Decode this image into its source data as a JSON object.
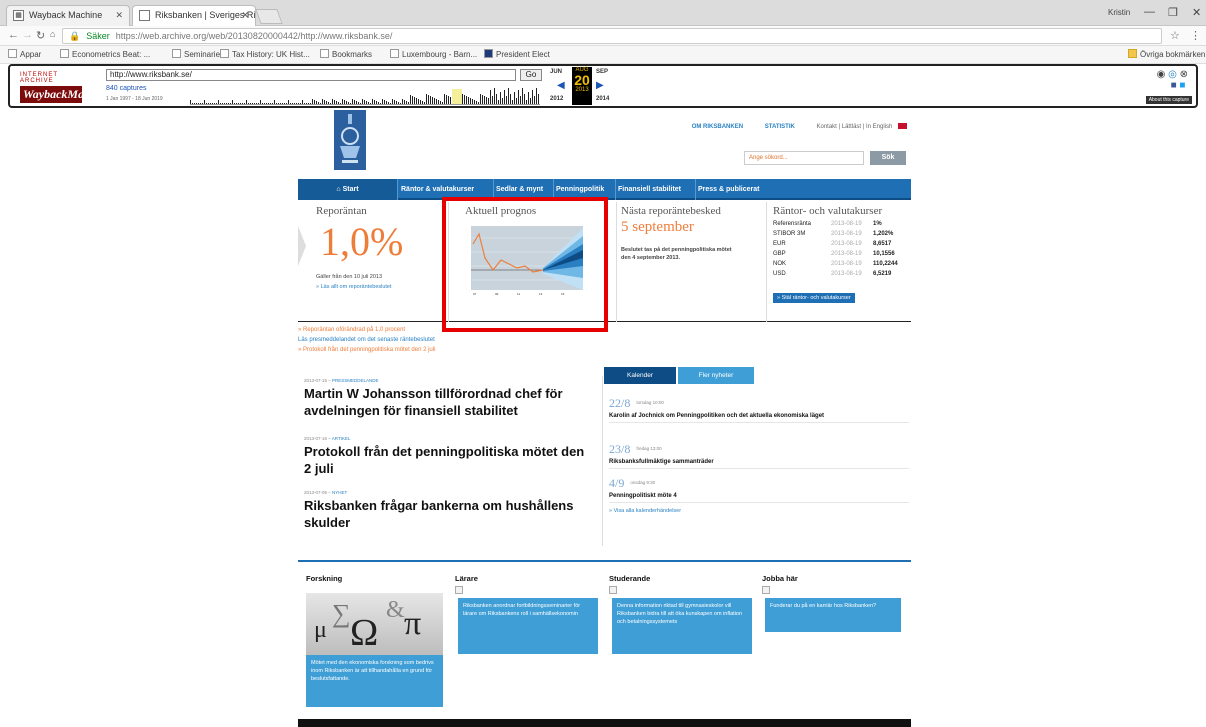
{
  "browser": {
    "tabs": [
      {
        "title": "Wayback Machine",
        "icon": "wayback-favicon"
      },
      {
        "title": "Riksbanken | Sveriges Ri...",
        "icon": "page-favicon"
      }
    ],
    "window_user": "Kristin",
    "address": {
      "security_label": "Säker",
      "url": "https://web.archive.org/web/20130820000442/http://www.riksbank.se/"
    },
    "bookmarks": [
      "Appar",
      "Econometrics Beat: ...",
      "Seminarier",
      "Tax History: UK Hist...",
      "Bookmarks",
      "Luxembourg - Barn...",
      "President Elect"
    ],
    "other_bookmarks": "Övriga bokmärken"
  },
  "wayback": {
    "logo_top": "INTERNET ARCHIVE",
    "logo_main": "WaybackMachine",
    "url_value": "http://www.riksbank.se/",
    "go_label": "Go",
    "captures": "840 captures",
    "range": "1 Jan 1997 - 18 Jun 2019",
    "prev_month": "JUN",
    "cur_month": "AUG",
    "next_month": "SEP",
    "day": "20",
    "prev_year": "2012",
    "cur_year": "2013",
    "next_year": "2014",
    "about": "About this capture"
  },
  "site": {
    "toplinks": {
      "about": "OM RIKSBANKEN",
      "stats": "STATISTIK",
      "rest": "Kontakt  |  Lättläst  |  In English"
    },
    "search": {
      "placeholder": "Ange sökord...",
      "button": "Sök"
    },
    "nav": [
      "Start",
      "Räntor & valutakurser",
      "Sedlar & mynt",
      "Penningpolitik",
      "Finansiell stabilitet",
      "Press & publicerat"
    ],
    "repo": {
      "heading": "Reporäntan",
      "value": "1,0%",
      "since": "Gäller från den 10 juli 2013",
      "link": "» Läs allt om reporäntebeslutet"
    },
    "forecast": {
      "heading": "Aktuell prognos"
    },
    "next": {
      "heading": "Nästa reporäntebesked",
      "date": "5 september",
      "text": "Beslutet tas på det penningpolitiska mötet den 4 september 2013."
    },
    "rates": {
      "heading": "Räntor- och valutakurser",
      "rows": [
        {
          "name": "Referensränta",
          "date": "2013-08-19",
          "value": "1%"
        },
        {
          "name": "STIBOR 3M",
          "date": "2013-08-19",
          "value": "1,202%"
        },
        {
          "name": "EUR",
          "date": "2013-08-19",
          "value": "8,6517"
        },
        {
          "name": "GBP",
          "date": "2013-08-19",
          "value": "10,1556"
        },
        {
          "name": "NOK",
          "date": "2013-08-19",
          "value": "110,2244"
        },
        {
          "name": "USD",
          "date": "2013-08-19",
          "value": "6,5219"
        }
      ],
      "button": "» Stäl räntor- och valutakurser"
    },
    "links": [
      "» Reporäntan oförändrad på 1,0 procent",
      "Läs presmeddelandet om det senaste räntebeslutet",
      "» Protokoll från det penningpolitiska mötet den 2 juli"
    ],
    "articles": [
      {
        "date": "2013-07-15",
        "tag": "PRESSMEDDELANDE",
        "title": "Martin W Johansson tillförordnad chef för avdelningen för finansiell stabilitet"
      },
      {
        "date": "2013-07-16",
        "tag": "ARTIKEL",
        "title": "Protokoll från det penningpolitiska mötet den 2 juli"
      },
      {
        "date": "2013-07-05",
        "tag": "NYHET",
        "title": "Riksbanken frågar bankerna om hushållens skulder"
      }
    ],
    "calendar": {
      "tab_active": "Kalender",
      "tab_other": "Fler nyheter",
      "events": [
        {
          "date": "22/8",
          "time": "torsdag 10:00",
          "text": "Karolin af Jochnick om Penningpolitiken och det aktuella ekonomiska läget"
        },
        {
          "date": "23/8",
          "time": "fredag 13:00",
          "text": "Riksbanksfullmäktige sammanträder"
        },
        {
          "date": "4/9",
          "time": "onsdag 9:30",
          "text": "Penningpolitiskt möte 4"
        }
      ],
      "more": "» Visa alla kalenderhändelser"
    },
    "cards": [
      {
        "title": "Forskning",
        "text": "Mötet med den ekonomiska forskning som bedrivs inom Riksbanken är att tillhandahålla en grund för beslutsfattande."
      },
      {
        "title": "Lärare",
        "text": "Riksbanken anordnar fortbildningsseminarier för lärare om Riksbankens roll i samhällsekonomin"
      },
      {
        "title": "Studerande",
        "text": "Denna information riktad till gymnasieskolor vill Riksbanken bidra till att öka kunskapen om inflation och betalningssystemets"
      },
      {
        "title": "Jobba här",
        "text": "Funderar du på en karriär hos Riksbanken?"
      }
    ],
    "greek": "μ∑Ω&π"
  },
  "colors": {
    "accent": "#1f6fb5",
    "orange": "#ef7d3a",
    "highlight": "#e60000"
  }
}
